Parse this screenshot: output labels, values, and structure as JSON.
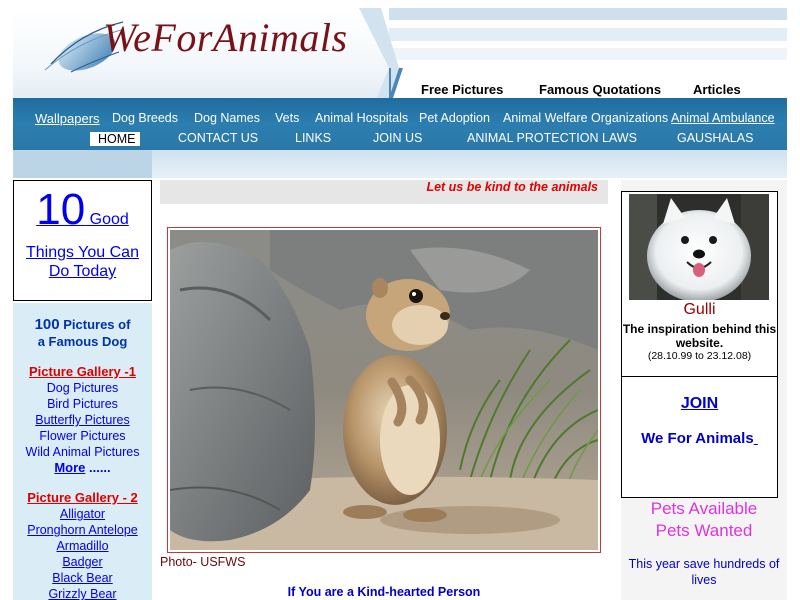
{
  "header": {
    "logo_text": "WeForAnimals",
    "top_links": [
      "Free Pictures",
      "Famous Quotations",
      "Articles"
    ]
  },
  "nav": {
    "row1": [
      "Wallpapers",
      "Dog Breeds",
      "Dog Names",
      "Vets",
      "Animal Hospitals",
      "Pet Adoption",
      "Animal Welfare Organizations",
      "Animal Ambulance"
    ],
    "row2": [
      "HOME",
      "CONTACT US",
      "LINKS",
      "JOIN US",
      "ANIMAL PROTECTION LAWS",
      "GAUSHALAS"
    ]
  },
  "left": {
    "ten_number": "10",
    "ten_good": " Good",
    "ten_rest": "Things You Can Do Today",
    "hundred_number": "100",
    "hundred_rest": " Pictures of",
    "hundred_line2": "a Famous Dog",
    "gallery1_title": "Picture Gallery -1",
    "gallery1_items": [
      "Dog Pictures",
      "Bird Pictures",
      "Butterfly Pictures",
      "Flower Pictures",
      "Wild Animal Pictures"
    ],
    "more_label": "More",
    "more_dots": " ......",
    "gallery2_title": "Picture Gallery - 2",
    "gallery2_items": [
      "Alligator",
      "Pronghorn Antelope",
      "Armadillo",
      "Badger",
      "Black Bear",
      "Grizzly Bear"
    ]
  },
  "center": {
    "tagline": "Let us be kind to the animals",
    "photo_credit": "Photo- USFWS",
    "kind_heading": "If You are a Kind-hearted Person"
  },
  "right": {
    "dog_name": "Gulli",
    "dog_desc": "The inspiration behind this website.",
    "dog_dates": "(28.10.99 to 23.12.08)",
    "join_label": "JOIN",
    "wfa_label": "We For Animals",
    "pets_available": "Pets Available",
    "pets_wanted": "Pets Wanted",
    "save_text": "This year save hundreds of lives"
  },
  "colors": {
    "nav_blue": "#2c7eb0",
    "logo_maroon": "#7a1018",
    "tagline_red": "#e60000",
    "link_blue": "#0000ee",
    "panel_lightblue": "#daecf6",
    "pets_magenta": "#dd33dd"
  }
}
